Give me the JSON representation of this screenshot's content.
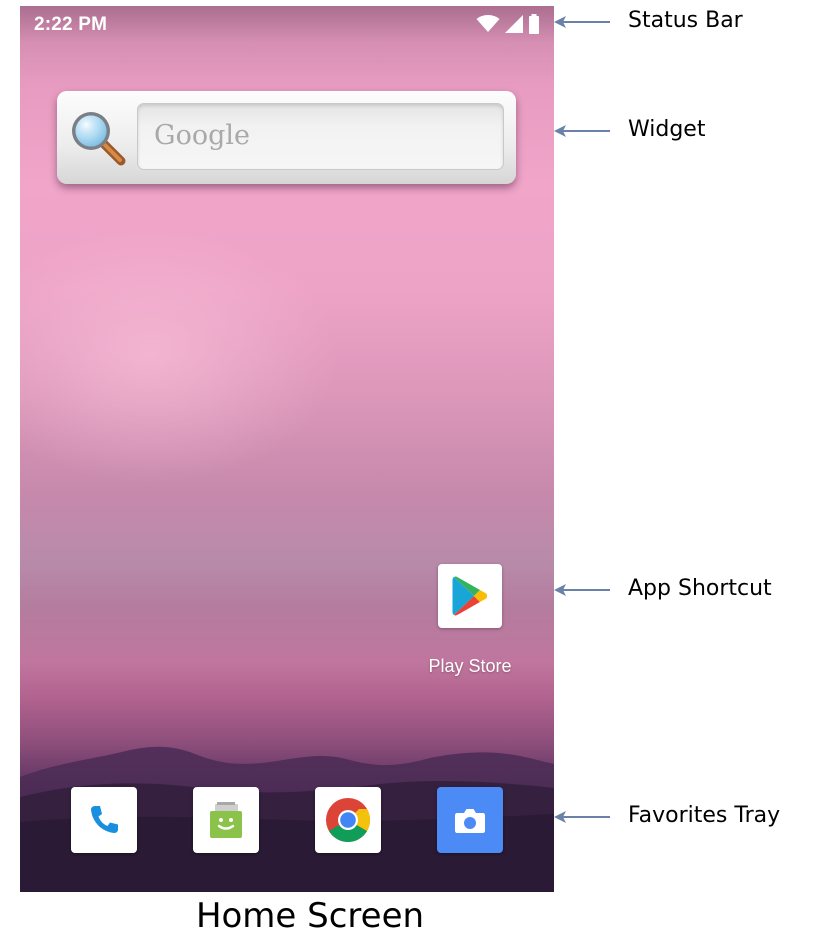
{
  "status_bar": {
    "time": "2:22 PM",
    "icons": [
      "wifi-icon",
      "cell-signal-icon",
      "battery-icon"
    ]
  },
  "widget": {
    "search_placeholder": "Google",
    "icon": "magnifier-icon"
  },
  "app_shortcut": {
    "label": "Play Store",
    "icon": "play-store-icon"
  },
  "favorites_tray": {
    "items": [
      "phone-icon",
      "messenger-icon",
      "chrome-icon",
      "camera-icon"
    ]
  },
  "annotations": {
    "status_bar": "Status Bar",
    "widget": "Widget",
    "app_shortcut": "App Shortcut",
    "favorites_tray": "Favorites Tray"
  },
  "caption": "Home Screen",
  "colors": {
    "wallpaper_top": "#e79bc0",
    "wallpaper_bottom": "#2c1d3a",
    "arrow": "#6b82a8",
    "camera_blue": "#4c8bf5"
  }
}
